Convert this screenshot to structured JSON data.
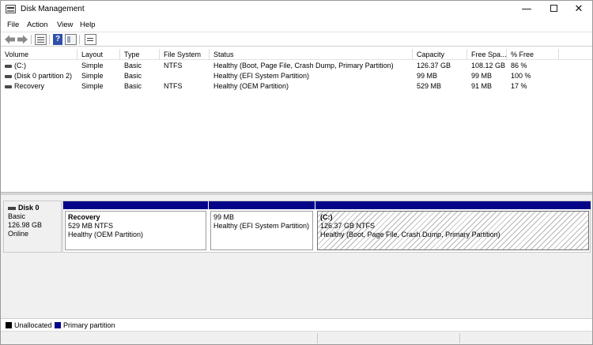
{
  "window": {
    "title": "Disk Management",
    "minimize": "—",
    "close": "✕"
  },
  "menu": [
    "File",
    "Action",
    "View",
    "Help"
  ],
  "toolbar": {
    "icons": [
      "back-icon",
      "forward-icon",
      "properties-icon",
      "help-icon",
      "list-icon",
      "console-icon"
    ]
  },
  "volume_list": {
    "columns": [
      "Volume",
      "Layout",
      "Type",
      "File System",
      "Status",
      "Capacity",
      "Free Spa...",
      "% Free"
    ],
    "rows": [
      [
        "(C:)",
        "Simple",
        "Basic",
        "NTFS",
        "Healthy (Boot, Page File, Crash Dump, Primary Partition)",
        "126.37 GB",
        "108.12 GB",
        "86 %"
      ],
      [
        "(Disk 0 partition 2)",
        "Simple",
        "Basic",
        "",
        "Healthy (EFI System Partition)",
        "99 MB",
        "99 MB",
        "100 %"
      ],
      [
        "Recovery",
        "Simple",
        "Basic",
        "NTFS",
        "Healthy (OEM Partition)",
        "529 MB",
        "91 MB",
        "17 %"
      ]
    ]
  },
  "disk": {
    "name": "Disk 0",
    "type": "Basic",
    "size": "126.98 GB",
    "status": "Online",
    "partitions": [
      {
        "name": "Recovery",
        "size": "529 MB NTFS",
        "status": "Healthy (OEM Partition)"
      },
      {
        "name": "",
        "size": "99 MB",
        "status": "Healthy (EFI System Partition)"
      },
      {
        "name": "(C:)",
        "size": "126.37 GB NTFS",
        "status": "Healthy (Boot, Page File, Crash Dump, Primary Partition)"
      }
    ]
  },
  "legend": {
    "unallocated": "Unallocated",
    "primary": "Primary partition"
  },
  "colors": {
    "primary_partition": "#05058a",
    "unallocated": "#000000"
  }
}
